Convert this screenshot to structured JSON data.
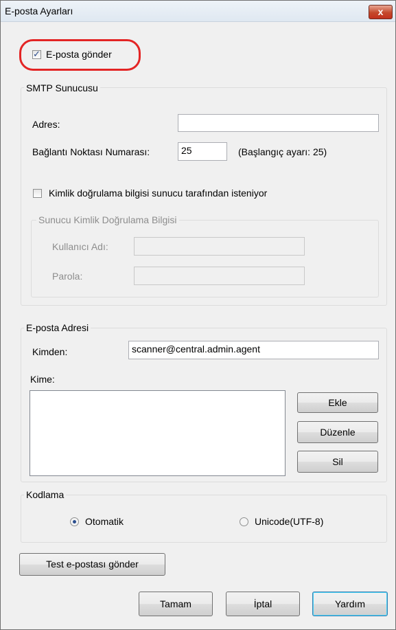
{
  "window": {
    "title": "E-posta Ayarları",
    "close_glyph": "x"
  },
  "send_email": {
    "label": "E-posta gönder",
    "checked": true
  },
  "smtp": {
    "group_title": "SMTP Sunucusu",
    "address_label": "Adres:",
    "address_value": "",
    "port_label": "Bağlantı Noktası Numarası:",
    "port_value": "25",
    "port_default_hint": "(Başlangıç ayarı: 25)",
    "auth_required_label": "Kimlik doğrulama bilgisi sunucu tarafından isteniyor",
    "auth_required_checked": false,
    "auth_group_title": "Sunucu Kimlik Doğrulama Bilgisi",
    "username_label": "Kullanıcı Adı:",
    "username_value": "",
    "password_label": "Parola:",
    "password_value": ""
  },
  "email_address": {
    "group_title": "E-posta Adresi",
    "from_label": "Kimden:",
    "from_value": "scanner@central.admin.agent",
    "to_label": "Kime:",
    "add_label": "Ekle",
    "edit_label": "Düzenle",
    "delete_label": "Sil"
  },
  "encoding": {
    "group_title": "Kodlama",
    "auto_label": "Otomatik",
    "auto_checked": true,
    "unicode_label": "Unicode(UTF-8)",
    "unicode_checked": false
  },
  "test_button_label": "Test e-postası gönder",
  "footer": {
    "ok_label": "Tamam",
    "cancel_label": "İptal",
    "help_label": "Yardım"
  },
  "colors": {
    "highlight": "#e32424",
    "default_button_border": "#3c7fb1"
  }
}
